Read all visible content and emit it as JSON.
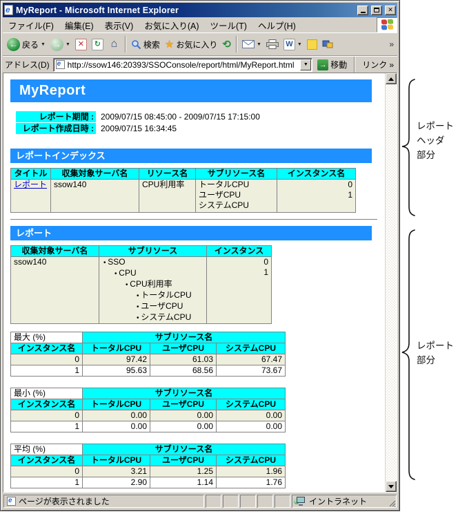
{
  "window": {
    "title": "MyReport - Microsoft Internet Explorer",
    "menu_items": [
      "ファイル(F)",
      "編集(E)",
      "表示(V)",
      "お気に入り(A)",
      "ツール(T)",
      "ヘルプ(H)"
    ],
    "toolbar": {
      "back_label": "戻る",
      "search_label": "検索",
      "favorites_label": "お気に入り",
      "overflow_chevron": "»"
    },
    "address": {
      "label": "アドレス(D)",
      "url": "http://ssow146:20393/SSOConsole/report/html/MyReport.html",
      "go_label": "移動",
      "links_label": "リンク",
      "links_chevron": "»"
    },
    "status": {
      "message": "ページが表示されました",
      "zone": "イントラネット"
    }
  },
  "page": {
    "title": "MyReport",
    "meta": [
      {
        "label": "レポート期間 :",
        "value": "2009/07/15 08:45:00 - 2009/07/15 17:15:00"
      },
      {
        "label": "レポート作成日時 :",
        "value": "2009/07/15 16:34:45"
      }
    ],
    "index": {
      "banner": "レポートインデックス",
      "headers": [
        "タイトル",
        "収集対象サーバ名",
        "リソース名",
        "サブリソース名",
        "インスタンス名"
      ],
      "row": {
        "title_link": "レポート",
        "server": "ssow140",
        "resource": "CPU利用率",
        "subresources": [
          "トータルCPU",
          "ユーザCPU",
          "システムCPU"
        ],
        "instances": [
          "0",
          "1"
        ]
      }
    },
    "report": {
      "banner": "レポート",
      "summary": {
        "headers": [
          "収集対象サーバ名",
          "サブリソース",
          "インスタンス"
        ],
        "server": "ssow140",
        "tree": [
          "SSO",
          "CPU",
          "CPU利用率",
          "トータルCPU",
          "ユーザCPU",
          "システムCPU"
        ],
        "instances": [
          "0",
          "1"
        ]
      },
      "stats": [
        {
          "metric": "最大 (%)",
          "span_header": "サブリソース名",
          "cols": [
            "インスタンス名",
            "トータルCPU",
            "ユーザCPU",
            "システムCPU"
          ],
          "rows": [
            [
              "0",
              "97.42",
              "61.03",
              "67.47"
            ],
            [
              "1",
              "95.63",
              "68.56",
              "73.67"
            ]
          ]
        },
        {
          "metric": "最小 (%)",
          "span_header": "サブリソース名",
          "cols": [
            "インスタンス名",
            "トータルCPU",
            "ユーザCPU",
            "システムCPU"
          ],
          "rows": [
            [
              "0",
              "0.00",
              "0.00",
              "0.00"
            ],
            [
              "1",
              "0.00",
              "0.00",
              "0.00"
            ]
          ]
        },
        {
          "metric": "平均 (%)",
          "span_header": "サブリソース名",
          "cols": [
            "インスタンス名",
            "トータルCPU",
            "ユーザCPU",
            "システムCPU"
          ],
          "rows": [
            [
              "0",
              "3.21",
              "1.25",
              "1.96"
            ],
            [
              "1",
              "2.90",
              "1.14",
              "1.76"
            ]
          ]
        }
      ]
    }
  },
  "annotations": {
    "header_brace_lines": [
      "レポート",
      "ヘッダ",
      "部分"
    ],
    "report_brace_lines": [
      "レポート",
      "部分"
    ]
  },
  "colors": {
    "section_banner_blue": "#1e90ff",
    "table_header_cyan": "#00ffff",
    "row_beige": "#efefde",
    "link_blue": "#0000cc",
    "titlebar_navy": "#0a246a"
  }
}
